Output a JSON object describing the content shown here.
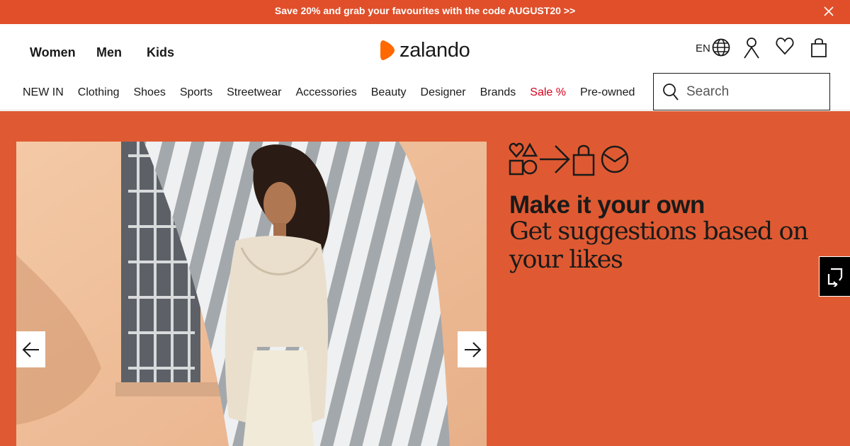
{
  "promo_bar": {
    "text": "Save 20% and grab your favourites with the code AUGUST20 >>",
    "background": "#e04f2a"
  },
  "header": {
    "gender_nav": [
      "Women",
      "Men",
      "Kids"
    ],
    "logo": {
      "text": "zalando",
      "accent": "#ff6900"
    },
    "language": "EN",
    "icons": [
      "globe-icon",
      "account-icon",
      "wishlist-heart-icon",
      "bag-icon"
    ],
    "categories": [
      {
        "label": "NEW IN"
      },
      {
        "label": "Clothing"
      },
      {
        "label": "Shoes"
      },
      {
        "label": "Sports"
      },
      {
        "label": "Streetwear"
      },
      {
        "label": "Accessories"
      },
      {
        "label": "Beauty"
      },
      {
        "label": "Designer"
      },
      {
        "label": "Brands"
      },
      {
        "label": "Sale %",
        "color": "#d5001c"
      },
      {
        "label": "Pre-owned"
      }
    ],
    "search": {
      "placeholder": "Search"
    }
  },
  "hero": {
    "background": "#df5a32",
    "title": "Make it your own",
    "subtitle": "Get suggestions based on your likes",
    "carousel": {
      "prev_icon": "arrow-left-icon",
      "next_icon": "arrow-right-icon"
    },
    "promo_icons": [
      "shapes-icon",
      "arrow-right-icon",
      "shopping-bag-icon",
      "smile-circle-icon"
    ]
  }
}
